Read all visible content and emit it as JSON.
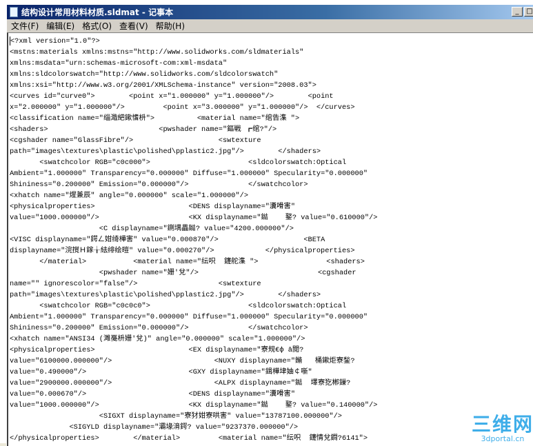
{
  "window": {
    "title": "结构设计常用材料材质.sldmat - 记事本",
    "minimize_label": "_",
    "maximize_label": "□"
  },
  "menu": [
    "文件(F)",
    "编辑(E)",
    "格式(O)",
    "查看(V)",
    "帮助(H)"
  ],
  "editor": {
    "lines": [
      "<?xml version=\"1.0\"?>",
      "<mstns:materials xmlns:mstns=\"http://www.solidworks.com/sldmaterials\"",
      "xmlns:msdata=\"urn:schemas-microsoft-com:xml-msdata\"",
      "xmlns:sldcolorswatch=\"http://www.solidworks.com/sldcolorswatch\"",
      "xmlns:xsi=\"http://www.w3.org/2001/XMLSchema-instance\" version=\"2008.03\">",
      "<curves id=\"curve0\">        <point x=\"1.000000\" y=\"1.000000\"/>        <point",
      "x=\"2.000000\" y=\"1.000000\"/>         <point x=\"3.000000\" y=\"1.000000\"/>  </curves>",
      "<classification name=\"缁濈紦鏉愭枡\">          <material name=\"绾告潗 \">",
      "<shaders>                          <pwshader name=\"鏂戦 ┏绾?\"/>",
      "<cgshader name=\"GlassFibre\"/>                    <swtexture",
      "path=\"images\\textures\\plastic\\polished\\pplastic2.jpg\"/>        </shaders>",
      "       <swatchcolor RGB=\"c0c000\">                       <sldcolorswatch:Optical",
      "Ambient=\"1.000000\" Transparency=\"0.000000\" Diffuse=\"1.000000\" Specularity=\"0.000000\"",
      "Shininess=\"0.200000\" Emission=\"0.000000\"/>              </swatchcolor>",
      "<xhatch name=\"煋兼辰\" angle=\"0.000000\" scale=\"1.000000\"/>",
      "<physicalproperties>                      <DENS displayname=\"瀵嗗害\"",
      "value=\"1000.000000\"/>                     <KX displayname=\"鐑    鐜? value=\"0.610000\"/>",
      "                     <C displayname=\"鍘堣畾鐑? value=\"4200.000000\"/>",
      "<VISC displayname=\"鍔ㄥ姏绮樺害\" value=\"0.000870\"/>                    <BETA",
      "displayname=\"浣撹Ｈ鎵╁紶绯绘暟\" value=\"0.000270\"/>            </physicalproperties>",
      "       </material>           <material name=\"纭呮  鑳舵潗 \">                <shaders>",
      "                     <pwshader name=\"姗′兌\"/>                            <cgshader",
      "name=\"\" ignorescolor=\"false\"/>                   <swtexture",
      "path=\"images\\textures\\plastic\\polished\\pplastic2.jpg\"/>        </shaders>",
      "       <swatchcolor RGB=\"c0c0c0\">                       <sldcolorswatch:Optical",
      "Ambient=\"1.000000\" Transparency=\"0.000000\" Diffuse=\"1.000000\" Specularity=\"0.000000\"",
      "Shininess=\"0.200000\" Emission=\"0.000000\"/>              </swatchcolor>",
      "<xhatch name=\"ANSI34 (濉戞枡姗′兌)\" angle=\"0.000000\" scale=\"1.000000\"/>",
      "<physicalproperties>                      <EX displayname=\"寮规€ф ā閲?",
      "value=\"6100000.000000\"/>                        <NUXY displayname=\"鏅   桶鏉炬寮鍫?",
      "value=\"0.490000\"/>                        <GXY displayname=\"鍓樺垏妯￠噺\"",
      "value=\"2900000.000000\"/>                        <ALPX displayname=\"鐑  墿寮犵郴鏁?",
      "value=\"0.000670\"/>                        <DENS displayname=\"瀵嗗害\"",
      "value=\"1000.000000\"/>                     <KX displayname=\"鐑    鐜? value=\"0.140000\"/>",
      "                     <SIGXT displayname=\"寮犲姏寮哄害\" value=\"13787100.000000\"/>",
      "              <SIGYLD displayname=\"灞堟湇鍔? value=\"9237370.000000\"/>",
      "</physicalproperties>        </material>         <material name=\"纭呮  鑳情兌鐧?6141\">"
    ]
  },
  "watermark": {
    "logo_text": "三维网",
    "site": "3dportal.cn"
  }
}
